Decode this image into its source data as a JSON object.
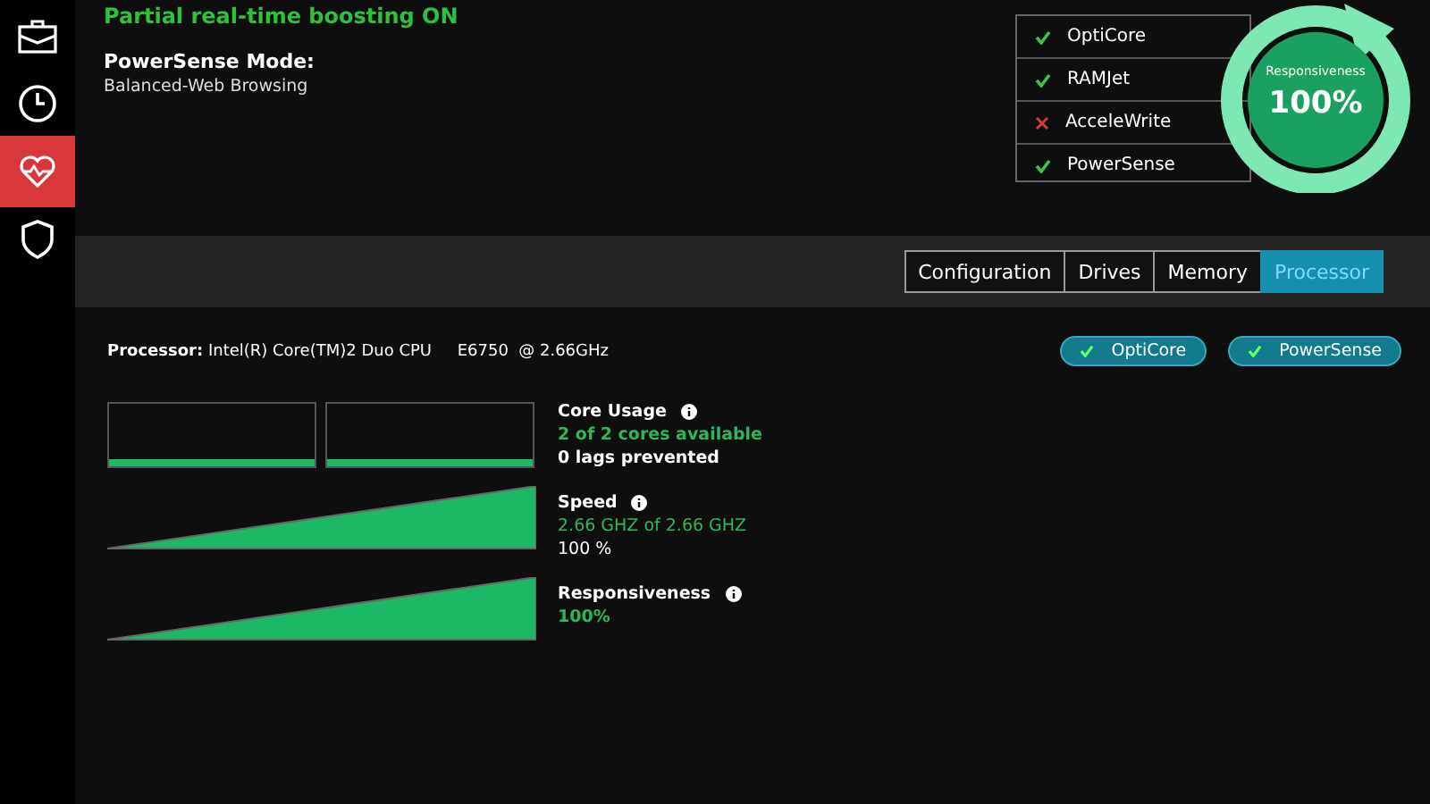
{
  "sidebar": {
    "items": [
      {
        "selected": false
      },
      {
        "selected": false
      },
      {
        "selected": true
      },
      {
        "selected": false
      }
    ]
  },
  "status": {
    "headline": "Partial real-time boosting ON",
    "mode_label": "PowerSense Mode:",
    "mode_value": "Balanced-Web Browsing"
  },
  "features": [
    {
      "name": "OptiCore",
      "on": true
    },
    {
      "name": "RAMJet",
      "on": true
    },
    {
      "name": "AcceleWrite",
      "on": false
    },
    {
      "name": "PowerSense",
      "on": true
    }
  ],
  "gauge": {
    "label": "Responsiveness",
    "value": "100%"
  },
  "tabs": [
    {
      "label": "Configuration",
      "selected": false
    },
    {
      "label": "Drives",
      "selected": false
    },
    {
      "label": "Memory",
      "selected": false
    },
    {
      "label": "Processor",
      "selected": true
    }
  ],
  "processor": {
    "label": "Processor:",
    "value": "Intel(R) Core(TM)2 Duo CPU     E6750  @ 2.66GHz",
    "badges": [
      "OptiCore",
      "PowerSense"
    ],
    "cores": {
      "title": "Core Usage",
      "detail": "2 of 2 cores available",
      "note": "0 lags prevented"
    },
    "meters": [
      {
        "title": "Speed",
        "detail": "2.66 GHZ of 2.66 GHZ",
        "note": "100 %",
        "level": 1
      },
      {
        "title": "Responsiveness",
        "detail": "100%",
        "level": 1
      }
    ]
  }
}
